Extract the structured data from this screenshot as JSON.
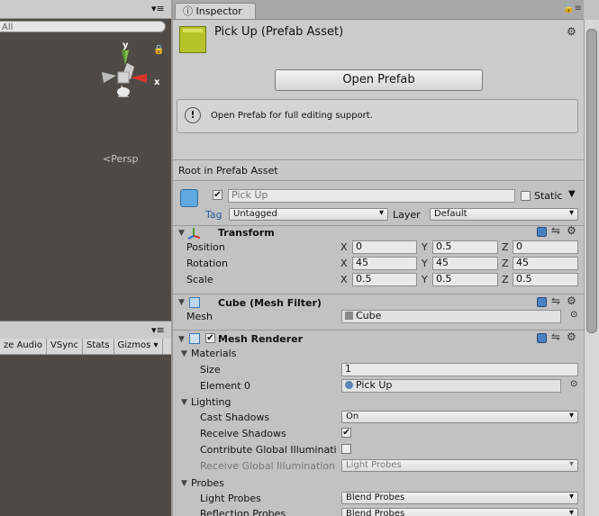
{
  "scene": {
    "search_placeholder": "All",
    "persp_label": "Persp",
    "axis_y": "y",
    "axis_x": "x"
  },
  "game": {
    "toolbar": [
      "ze Audio",
      "VSync",
      "Stats",
      "Gizmos"
    ]
  },
  "inspector": {
    "tab_label": "Inspector",
    "prefab_title": "Pick Up (Prefab Asset)",
    "open_prefab_button": "Open Prefab",
    "help_text": "Open Prefab for full editing support.",
    "root_label": "Root in Prefab Asset",
    "object_name": "Pick Up",
    "static_label": "Static",
    "tag_label": "Tag",
    "tag_value": "Untagged",
    "layer_label": "Layer",
    "layer_value": "Default"
  },
  "transform": {
    "title": "Transform",
    "rows": [
      {
        "label": "Position",
        "x": "0",
        "y": "0.5",
        "z": "0"
      },
      {
        "label": "Rotation",
        "x": "45",
        "y": "45",
        "z": "45"
      },
      {
        "label": "Scale",
        "x": "0.5",
        "y": "0.5",
        "z": "0.5"
      }
    ],
    "axis_labels": [
      "X",
      "Y",
      "Z"
    ]
  },
  "mesh_filter": {
    "title": "Cube (Mesh Filter)",
    "mesh_label": "Mesh",
    "mesh_value": "Cube"
  },
  "mesh_renderer": {
    "title": "Mesh Renderer",
    "materials_label": "Materials",
    "size_label": "Size",
    "size_value": "1",
    "element0_label": "Element 0",
    "element0_value": "Pick Up",
    "lighting_label": "Lighting",
    "cast_shadows_label": "Cast Shadows",
    "cast_shadows_value": "On",
    "receive_shadows_label": "Receive Shadows",
    "contribute_gi_label": "Contribute Global Illuminati",
    "receive_gi_label": "Receive Global Illumination",
    "receive_gi_value": "Light Probes",
    "probes_label": "Probes",
    "light_probes_label": "Light Probes",
    "light_probes_value": "Blend Probes",
    "reflection_probes_label": "Reflection Probes",
    "reflection_probes_value": "Blend Probes"
  },
  "colors": {
    "scene_bg": "#4f4a45",
    "inspector_bg": "#c2c2c2",
    "prefab_cube": "#b5c42a"
  }
}
